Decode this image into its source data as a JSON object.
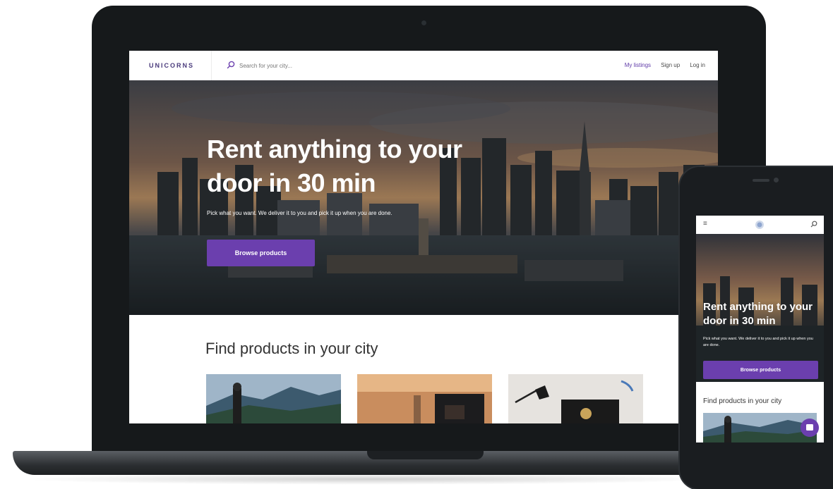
{
  "desktop": {
    "logo": "UNICORNS",
    "search": {
      "placeholder": "Search for your city..."
    },
    "nav": {
      "my_listings": "My listings",
      "sign_up": "Sign up",
      "log_in": "Log in"
    },
    "hero": {
      "title": "Rent anything to your door in 30 min",
      "subtitle": "Pick what you want. We deliver it to you and pick it up when you are done.",
      "cta": "Browse products"
    },
    "products_title": "Find products in your city"
  },
  "mobile": {
    "menu_icon": "≡",
    "hero": {
      "title": "Rent anything to your door in 30 min",
      "subtitle": "Pick what you want. We deliver it to you and pick it up when you are done.",
      "cta": "Browse products"
    },
    "products_title": "Find products in your city"
  },
  "colors": {
    "accent": "#6b3fae",
    "logo": "#4a3b7c",
    "link_active": "#5f3aa8",
    "device": "#16191b"
  },
  "icons": [
    "search-icon",
    "logo-icon",
    "chat-icon",
    "hamburger-menu-icon"
  ]
}
